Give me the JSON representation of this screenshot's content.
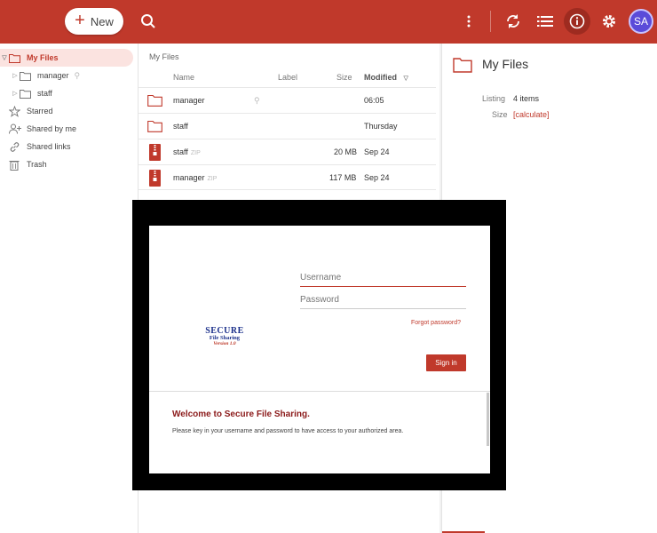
{
  "topbar": {
    "new_label": "New",
    "avatar_initials": "SA"
  },
  "sidebar": {
    "items": [
      {
        "label": "My Files"
      },
      {
        "label": "manager"
      },
      {
        "label": "staff"
      },
      {
        "label": "Starred"
      },
      {
        "label": "Shared by me"
      },
      {
        "label": "Shared links"
      },
      {
        "label": "Trash"
      }
    ]
  },
  "list": {
    "breadcrumb": "My Files",
    "columns": {
      "name": "Name",
      "label": "Label",
      "size": "Size",
      "modified": "Modified"
    },
    "rows": [
      {
        "name": "manager",
        "tag": "",
        "size": "",
        "modified": "06:05"
      },
      {
        "name": "staff",
        "tag": "",
        "size": "",
        "modified": "Thursday"
      },
      {
        "name": "staff",
        "tag": "ZIP",
        "size": "20 MB",
        "modified": "Sep 24"
      },
      {
        "name": "manager",
        "tag": "ZIP",
        "size": "117 MB",
        "modified": "Sep 24"
      }
    ]
  },
  "details": {
    "title": "My Files",
    "listing_label": "Listing",
    "listing_value": "4 items",
    "size_label": "Size",
    "size_value": "[calculate]"
  },
  "login": {
    "username_placeholder": "Username",
    "password_placeholder": "Password",
    "forgot": "Forgot password?",
    "signin": "Sign in",
    "logo_line1": "Secure",
    "logo_line2": "File Sharing",
    "logo_line3": "Version 1.0",
    "welcome_title": "Welcome to Secure File Sharing.",
    "welcome_text": "Please key in your username and password to have access to your authorized area."
  },
  "colors": {
    "accent": "#c0392b",
    "avatar": "#5b4bd9"
  }
}
